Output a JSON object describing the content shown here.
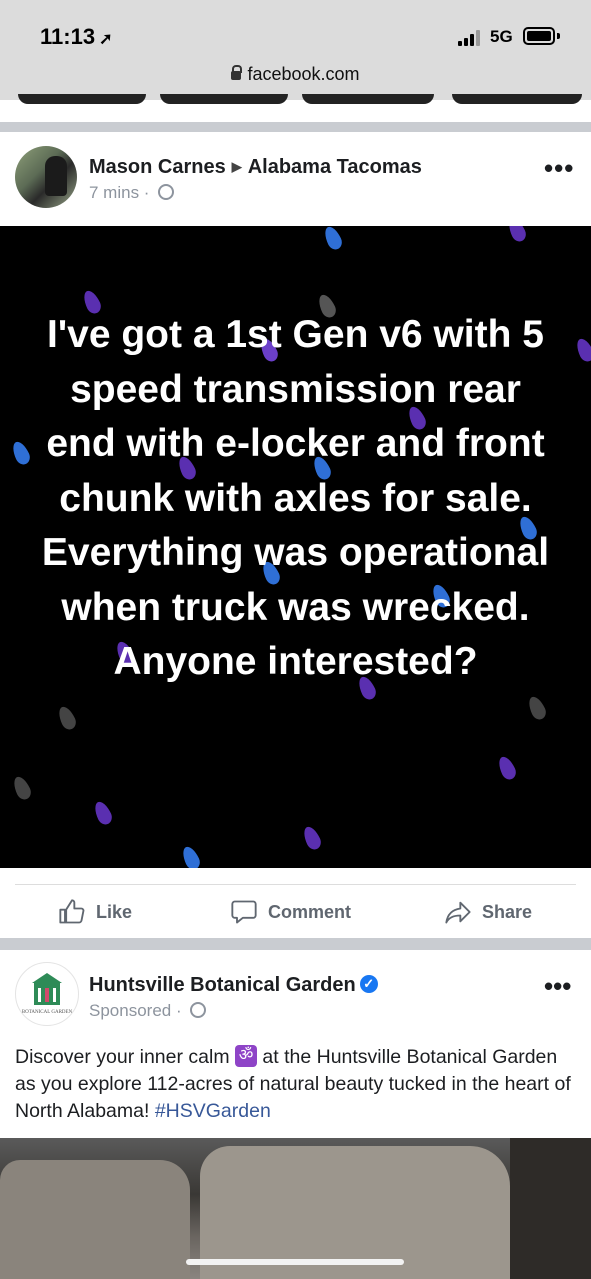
{
  "status": {
    "time": "11:13",
    "network": "5G",
    "url": "facebook.com"
  },
  "post": {
    "author": "Mason Carnes",
    "group": "Alabama Tacomas",
    "time": "7 mins · ",
    "text": "I've got a 1st Gen v6 with 5 speed transmission rear end with e-locker and front chunk with axles for sale. Everything was operational when truck was wrecked. Anyone interested?",
    "actions": {
      "like": "Like",
      "comment": "Comment",
      "share": "Share"
    }
  },
  "ad": {
    "name": "Huntsville Botanical Garden",
    "sponsored": "Sponsored · ",
    "text_before": "Discover your inner calm ",
    "emoji": "ॐ",
    "text_after": " at the Huntsville Botanical Garden as you explore 112-acres of natural beauty tucked in the heart of North Alabama! ",
    "hashtag": "#HSVGarden",
    "logo_caption": "BOTANICAL GARDEN"
  },
  "colors": {
    "accent": "#1877f2",
    "drops_blue": "#2f6fd6",
    "drops_purple": "#6b3fc9",
    "link": "#385898"
  }
}
